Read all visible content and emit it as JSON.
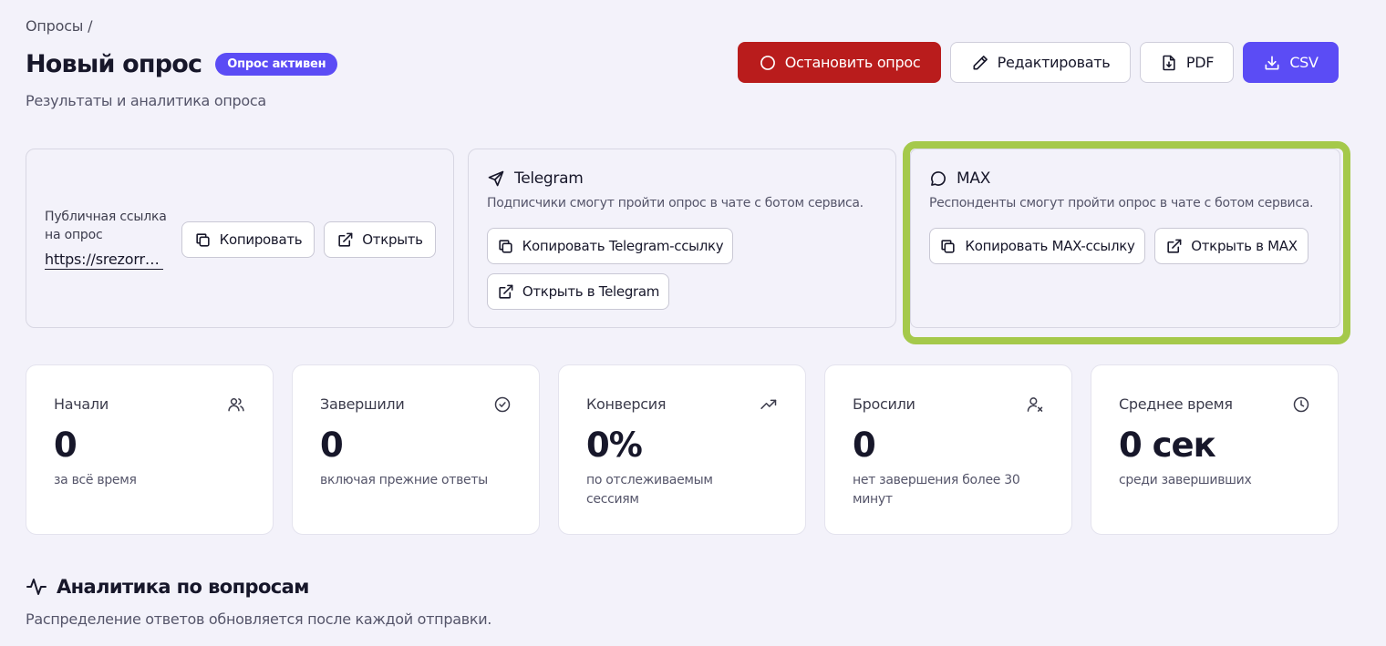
{
  "breadcrumb": "Опросы /",
  "header": {
    "title": "Новый опрос",
    "status_badge": "Опрос активен",
    "subtitle": "Результаты и аналитика опроса"
  },
  "actions": {
    "stop_label": "Остановить опрос",
    "edit_label": "Редактировать",
    "pdf_label": "PDF",
    "csv_label": "CSV"
  },
  "public_link": {
    "label": "Публичная ссылка на опрос",
    "url": "https://srezorr…",
    "copy_label": "Копировать",
    "open_label": "Открыть"
  },
  "telegram": {
    "title": "Telegram",
    "description": "Подписчики смогут пройти опрос в чате с ботом сервиса.",
    "copy_label": "Копировать Telegram-ссылку",
    "open_label": "Открыть в Telegram"
  },
  "max": {
    "title": "MAX",
    "description": "Респонденты смогут пройти опрос в чате с ботом сервиса.",
    "copy_label": "Копировать MAX-ссылку",
    "open_label": "Открыть в MAX"
  },
  "stats": [
    {
      "label": "Начали",
      "value": "0",
      "sub": "за всё время",
      "icon": "users-icon"
    },
    {
      "label": "Завершили",
      "value": "0",
      "sub": "включая прежние ответы",
      "icon": "check-circle-icon"
    },
    {
      "label": "Конверсия",
      "value": "0%",
      "sub": "по отслеживаемым сессиям",
      "icon": "trending-up-icon"
    },
    {
      "label": "Бросили",
      "value": "0",
      "sub": "нет завершения более 30 минут",
      "icon": "user-x-icon"
    },
    {
      "label": "Среднее время",
      "value": "0 сек",
      "sub": "среди завершивших",
      "icon": "clock-icon"
    }
  ],
  "analytics": {
    "title": "Аналитика по вопросам",
    "subtitle": "Распределение ответов обновляется после каждой отправки."
  },
  "colors": {
    "accent": "#5b4cf5",
    "danger": "#b91c1c",
    "highlight": "#a5c94b",
    "background": "#f3f2fa"
  }
}
